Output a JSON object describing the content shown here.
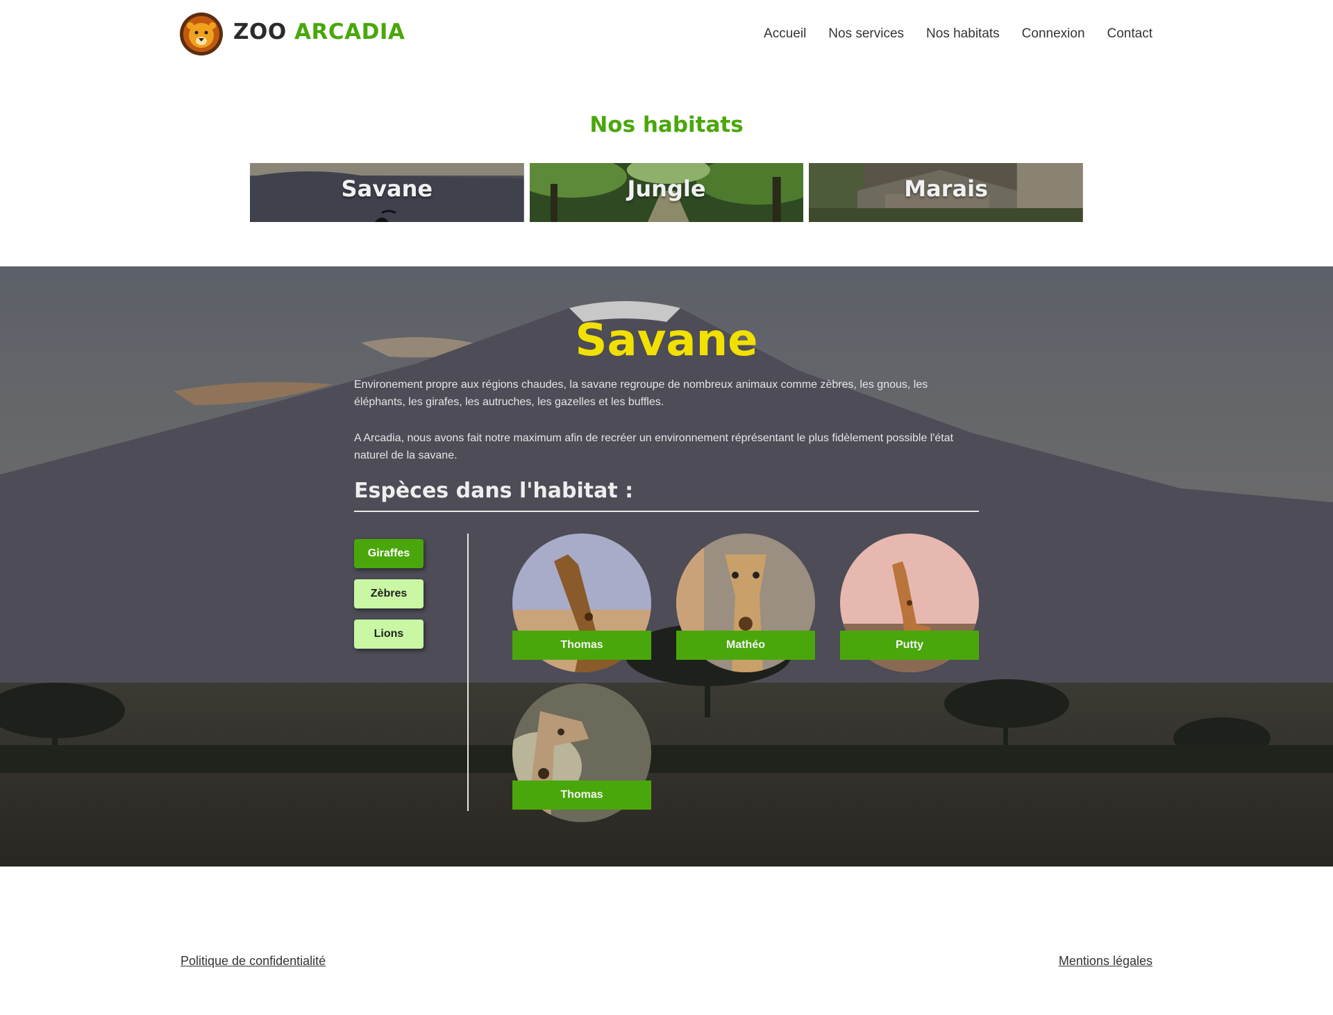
{
  "header": {
    "brand_part1": "ZOO",
    "brand_part2": "ARCADIA",
    "nav": [
      "Accueil",
      "Nos services",
      "Nos habitats",
      "Connexion",
      "Contact"
    ]
  },
  "habitats": {
    "title": "Nos habitats",
    "cards": [
      "Savane",
      "Jungle",
      "Marais"
    ]
  },
  "selected_habitat": {
    "title": "Savane",
    "description_1": "Environement propre aux régions chaudes, la savane regroupe de nombreux animaux comme  zèbres, les gnous, les éléphants, les girafes, les autruches, les gazelles et les buffles.",
    "description_2": "A Arcadia, nous avons fait notre maximum afin de recréer un environnement réprésentant le plus fidèlement possible l'état naturel de la savane.",
    "species_title": "Espèces dans l'habitat :",
    "species_buttons": [
      {
        "label": "Giraffes",
        "active": true
      },
      {
        "label": "Zèbres",
        "active": false
      },
      {
        "label": "Lions",
        "active": false
      }
    ],
    "animals": [
      "Thomas",
      "Mathéo",
      "Putty",
      "Thomas"
    ]
  },
  "footer": {
    "left_link": "Politique de confidentialité",
    "right_link": "Mentions légales"
  },
  "colors": {
    "brand_green": "#4aa70b",
    "title_yellow": "#f2e000",
    "inactive_button": "#c9f7a4"
  }
}
